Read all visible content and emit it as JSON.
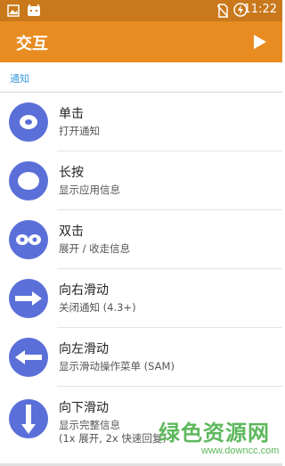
{
  "status_bar": {
    "time": "11:22",
    "left_icons": [
      "image-icon",
      "android-icon"
    ],
    "right_icons": [
      "no-sim-icon",
      "battery-charging-icon"
    ]
  },
  "app_bar": {
    "title": "交互",
    "action_icon": "play-icon",
    "color": "#e88c22"
  },
  "section": {
    "header": "通知"
  },
  "gestures": [
    {
      "title": "单击",
      "subtitle": "打开通知",
      "icon": "single-tap-icon"
    },
    {
      "title": "长按",
      "subtitle": "显示应用信息",
      "icon": "long-press-icon"
    },
    {
      "title": "双击",
      "subtitle": "展开 / 收走信息",
      "icon": "double-tap-icon"
    },
    {
      "title": "向右滑动",
      "subtitle": "关闭通知 (4.3+)",
      "icon": "swipe-right-icon"
    },
    {
      "title": "向左滑动",
      "subtitle": "显示滑动操作菜单 (SAM)",
      "icon": "swipe-left-icon"
    },
    {
      "title": "向下滑动",
      "subtitle": "显示完整信息",
      "subtitle2": "(1x 展开, 2x 快速回复)",
      "icon": "swipe-down-icon"
    }
  ],
  "watermark": {
    "main": "绿色资源网",
    "sub": "www.downcc.com"
  },
  "colors": {
    "status_bar": "#c9781b",
    "avatar": "#5a6fd8",
    "section_header": "#3a9ad9"
  }
}
